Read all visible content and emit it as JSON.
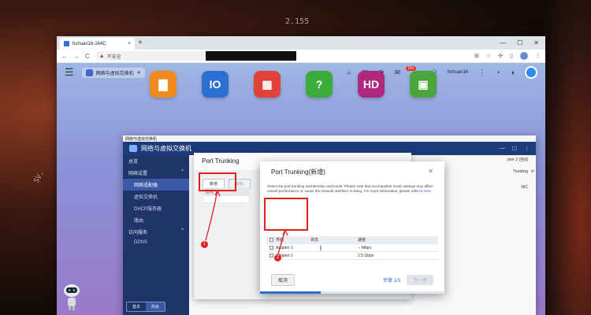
{
  "wallpaper": {
    "text_top": "2.155",
    "text_left": "SV."
  },
  "browser": {
    "tab_title": "hchuan16-264C",
    "tab_close": "×",
    "new_tab": "+",
    "win_min": "—",
    "win_max": "☐",
    "win_close": "✕",
    "security_label": "不安全",
    "back": "←",
    "forward": "→",
    "reload": "C"
  },
  "qts": {
    "open_tab": "网络与虚拟交换机",
    "open_tab_close": "✕",
    "notification_count": "10+",
    "username": "hchuan16",
    "apps": [
      {
        "name": "file-station",
        "color": "#f08a1d",
        "glyph": "▇"
      },
      {
        "name": "hybrid-backup",
        "color": "#2a6fd1",
        "glyph": "IO"
      },
      {
        "name": "app-center",
        "color": "#e0423a",
        "glyph": "▦"
      },
      {
        "name": "help-center",
        "color": "#3aac3a",
        "glyph": "?"
      },
      {
        "name": "hd-station",
        "color": "#b0287e",
        "glyph": "HD"
      },
      {
        "name": "container-station",
        "color": "#4aa63a",
        "glyph": "▣"
      }
    ]
  },
  "network_window": {
    "title_bar": "网络与虚拟交换机",
    "header": "网络与虚拟交换机",
    "sidebar": {
      "items": [
        {
          "label": "总览",
          "type": "item"
        },
        {
          "label": "网络设置",
          "type": "group",
          "arrow": "^"
        },
        {
          "label": "网络适配器",
          "type": "sub",
          "selected": true
        },
        {
          "label": "虚拟交换机",
          "type": "sub"
        },
        {
          "label": "DHCP服务器",
          "type": "sub"
        },
        {
          "label": "路由",
          "type": "sub"
        },
        {
          "label": "访问服务",
          "type": "group",
          "arrow": "^"
        },
        {
          "label": "DDNS",
          "type": "sub"
        }
      ],
      "mode_basic": "基本",
      "mode_advanced": "高级"
    },
    "right_peek_1": "pter 2 (自动",
    "right_peek_2": "Trunking",
    "right_peek_3": "NIC"
  },
  "port_trunking_dialog": {
    "title": "Port Trunking",
    "add_button": "新增",
    "delete_button": "删除",
    "row_label": "群组"
  },
  "add_dialog": {
    "title": "Port Trunking(新增)",
    "close": "✕",
    "description": "Select the port trunking membership and mode. Please note that incompatible mode settings may affect overall performance or cause the network interface to hang. For more information, please refer to",
    "description_link": "here",
    "columns": [
      "",
      "界面",
      "状态",
      "速度"
    ],
    "rows": [
      {
        "name": "Adapter 1",
        "status": "off",
        "speed": "-- Mbps"
      },
      {
        "name": "Adapter 2",
        "status": "on",
        "speed": "2.5 Gbps"
      }
    ],
    "cancel": "取消",
    "step": "步骤 1/3",
    "next": "下一步",
    "progress": 0.33
  },
  "annotations": {
    "label1": "1",
    "label2": "2"
  },
  "colors": {
    "annotation": "#e02020",
    "accent": "#2a6fd1",
    "sidebar": "#1f3468"
  }
}
